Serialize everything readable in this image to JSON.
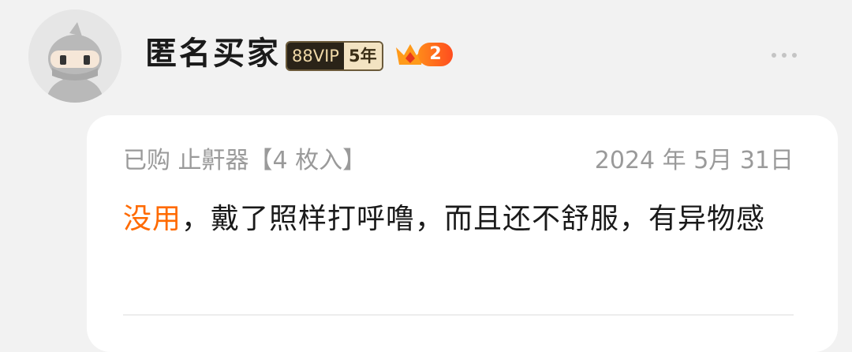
{
  "user": {
    "name": "匿名买家",
    "vip_label": "88VIP",
    "vip_years": "5年",
    "level": "2"
  },
  "review": {
    "purchase_info": "已购 止鼾器【4 枚入】",
    "date": "2024 年 5月 31日",
    "highlight": "没用",
    "text": "，戴了照样打呼噜，而且还不舒服，有异物感"
  },
  "colors": {
    "highlight": "#ff6a00",
    "card_bg": "#ffffff",
    "page_bg": "#f2f2f2",
    "level_badge": "#ff4d1f"
  },
  "icons": {
    "avatar": "anonymous-ninja-avatar",
    "crown": "crown-icon",
    "more": "more-dots-icon"
  }
}
